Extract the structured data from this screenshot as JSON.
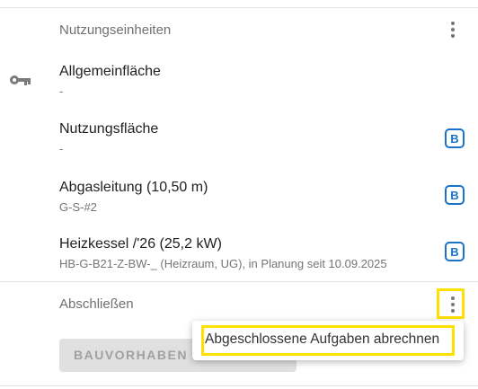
{
  "sections": {
    "units": {
      "header": "Nutzungseinheiten",
      "items": [
        {
          "title": "Allgemeinfläche",
          "subtitle": "-",
          "icon": "key-icon",
          "badge": ""
        },
        {
          "title": "Nutzungsfläche",
          "subtitle": "-",
          "badge": "B"
        },
        {
          "title": "Abgasleitung (10,50 m)",
          "subtitle": "G-S-#2",
          "badge": "B"
        },
        {
          "title": "Heizkessel /'26 (25,2 kW)",
          "subtitle": "HB-G-B21-Z-BW-_ (Heizraum, UG), in Planung seit 10.09.2025",
          "badge": "B"
        }
      ]
    },
    "close": {
      "header": "Abschließen",
      "button_label": "BAUVORHABEN ABSCHLIESSEN"
    }
  },
  "context_menu": {
    "items": [
      "Abgeschlossene Aufgaben abrechnen"
    ]
  },
  "colors": {
    "accent": "#1a73c8",
    "highlight": "#ffe100",
    "divider": "#e3e3e3"
  }
}
